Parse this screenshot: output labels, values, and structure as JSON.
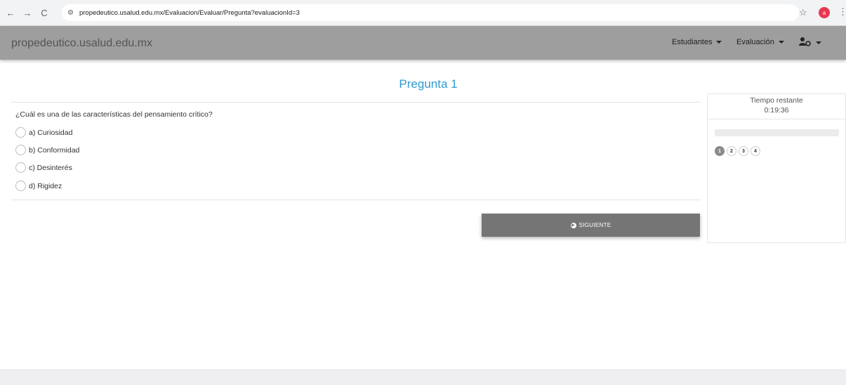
{
  "browser": {
    "back_icon": "←",
    "forward_icon": "→",
    "reload_icon": "C",
    "site_settings_icon": "⚙",
    "url": "propedeutico.usalud.edu.mx/Evaluacion/Evaluar/Pregunta?evaluacionId=3",
    "star_icon": "☆",
    "profile_initial": "a",
    "menu_icon": "⋮"
  },
  "navbar": {
    "brand": "propedeutico.usalud.edu.mx",
    "students_label": "Estudiantes",
    "evaluation_label": "Evaluación",
    "user_icon": "user-cog-icon"
  },
  "question": {
    "title": "Pregunta 1",
    "text": "¿Cuál es una de las características del pensamiento crítico?",
    "options": [
      {
        "label": "a) Curiosidad"
      },
      {
        "label": "b) Conformidad"
      },
      {
        "label": "c) Desinterés"
      },
      {
        "label": "d) Rigidez"
      }
    ]
  },
  "actions": {
    "next_label": "SIGUIENTE"
  },
  "sidebar": {
    "time_label": "Tiempo restante",
    "time_value": "0:19:36",
    "progress": 0,
    "question_numbers": [
      "1",
      "2",
      "3",
      "4"
    ],
    "current_question": "1"
  },
  "colors": {
    "accent": "#2e9ad0",
    "navbar": "#9e9e9e",
    "button": "#757575"
  }
}
